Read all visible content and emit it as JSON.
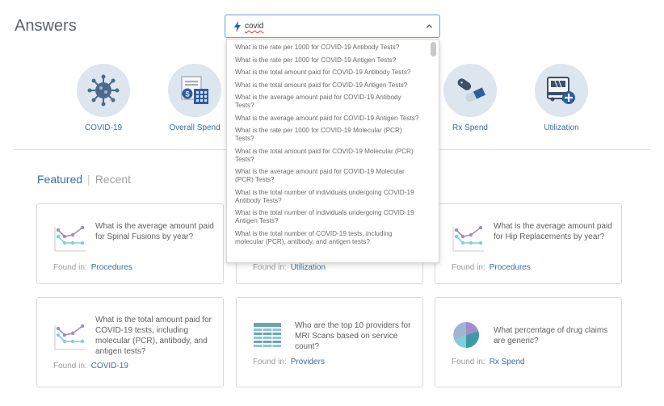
{
  "page": {
    "title": "Answers"
  },
  "search": {
    "query": "covid",
    "suggestions": [
      "What is the rate per 1000 for COVID-19 Antibody Tests?",
      "What is the rate per 1000 for COVID-19 Antigen Tests?",
      "What is the total amount paid for COVID-19 Antibody Tests?",
      "What is the total amount paid for COVID-19 Antigen Tests?",
      "What is the average amount paid for COVID-19 Antibody Tests?",
      "What is the average amount paid for COVID-19 Antigen Tests?",
      "What is the rate per 1000 for COVID-19 Molecular (PCR) Tests?",
      "What is the total amount paid for COVID-19 Molecular (PCR) Tests?",
      "What is the average amount paid for COVID-19 Molecular (PCR) Tests?",
      "What is the total number of individuals undergoing COVID-19 Antibody Tests?",
      "What is the total number of individuals undergoing COVID-19 Antigen Tests?",
      "What is the total number of COVID-19 tests, including molecular (PCR), antibody, and antigen tests?"
    ]
  },
  "categories": [
    {
      "label": "COVID-19",
      "icon": "virus-icon"
    },
    {
      "label": "Overall Spend",
      "icon": "spend-icon"
    },
    {
      "label": "Rx Spend",
      "icon": "pills-icon"
    },
    {
      "label": "Utilization",
      "icon": "ambulance-icon"
    }
  ],
  "tabs": {
    "featured": "Featured",
    "separator": "|",
    "recent": "Recent"
  },
  "found_in_label": "Found in:",
  "cards": [
    {
      "question": "What is the average amount paid for Spinal Fusions by year?",
      "category": "Procedures",
      "icon": "line-chart-icon"
    },
    {
      "question": "",
      "category": "Utilization",
      "icon": ""
    },
    {
      "question": "What is the average amount paid for Hip Replacements by year?",
      "category": "Procedures",
      "icon": "line-chart-icon"
    },
    {
      "question": "What is the total amount paid for COVID-19 tests, including molecular (PCR), antibody, and antigen tests?",
      "category": "COVID-19",
      "icon": "line-chart-icon"
    },
    {
      "question": "Who are the top 10 providers for MRI Scans based on service count?",
      "category": "Providers",
      "icon": "table-icon"
    },
    {
      "question": "What percentage of drug claims are generic?",
      "category": "Rx Spend",
      "icon": "pie-chart-icon"
    }
  ],
  "colors": {
    "accent": "#3a6ea8",
    "icon_circle": "#dde5ef",
    "purple": "#a48cc8",
    "teal": "#7fcfd8"
  }
}
